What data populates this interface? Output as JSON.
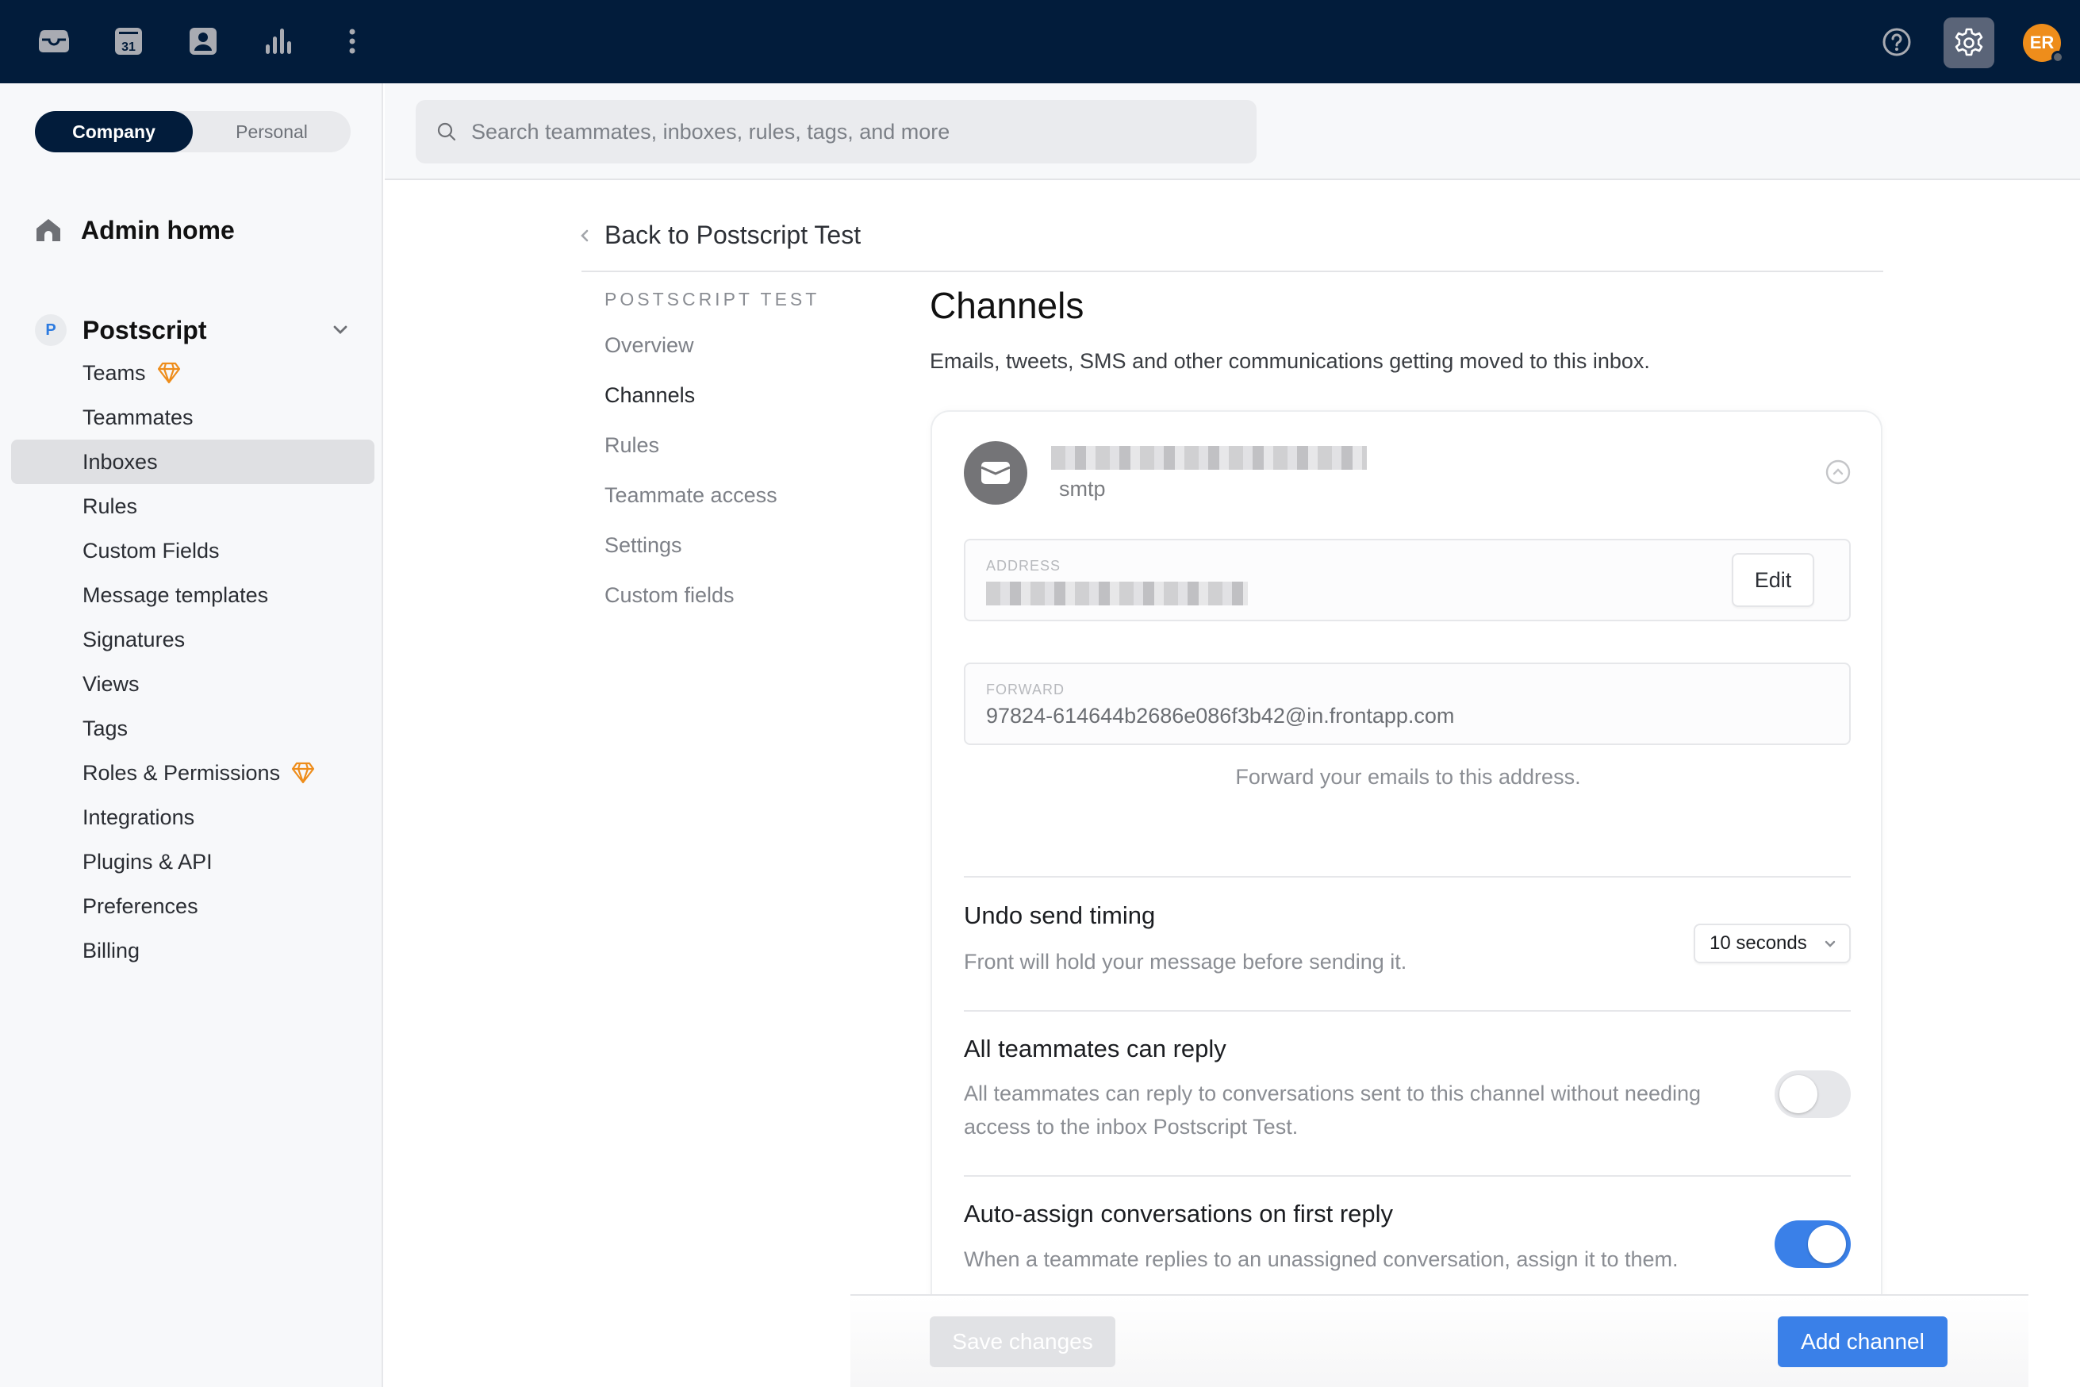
{
  "topbar": {
    "nav_icons": [
      "inbox-icon",
      "calendar-icon",
      "contacts-icon",
      "analytics-icon",
      "more-icon"
    ],
    "calendar_day": "31",
    "help_icon": "help-icon",
    "settings_icon": "gear-icon",
    "avatar_initials": "ER",
    "colors": {
      "bar": "#021c3b",
      "avatar": "#ee8d1b",
      "settings_active": "#5a6478"
    }
  },
  "sidebar": {
    "segments": {
      "company": "Company",
      "personal": "Personal",
      "selected": "Company"
    },
    "admin_home": "Admin home",
    "org": {
      "badge": "P",
      "name": "Postscript",
      "expanded": true
    },
    "items": [
      {
        "label": "Teams",
        "premium": true
      },
      {
        "label": "Teammates",
        "premium": false
      },
      {
        "label": "Inboxes",
        "premium": false,
        "active": true
      },
      {
        "label": "Rules",
        "premium": false
      },
      {
        "label": "Custom Fields",
        "premium": false
      },
      {
        "label": "Message templates",
        "premium": false
      },
      {
        "label": "Signatures",
        "premium": false
      },
      {
        "label": "Views",
        "premium": false
      },
      {
        "label": "Tags",
        "premium": false
      },
      {
        "label": "Roles & Permissions",
        "premium": true
      },
      {
        "label": "Integrations",
        "premium": false
      },
      {
        "label": "Plugins & API",
        "premium": false
      },
      {
        "label": "Preferences",
        "premium": false
      },
      {
        "label": "Billing",
        "premium": false
      }
    ]
  },
  "search": {
    "placeholder": "Search teammates, inboxes, rules, tags, and more",
    "value": ""
  },
  "breadcrumb": {
    "back_label": "Back to Postscript Test"
  },
  "subnav": {
    "title": "POSTSCRIPT TEST",
    "items": [
      "Overview",
      "Channels",
      "Rules",
      "Teammate access",
      "Settings",
      "Custom fields"
    ],
    "active": "Channels"
  },
  "main": {
    "title": "Channels",
    "description": "Emails, tweets, SMS and other communications getting moved to this inbox.",
    "channel": {
      "icon": "envelope-icon",
      "name_redacted": true,
      "type": "smtp",
      "address": {
        "label": "ADDRESS",
        "value_redacted": true,
        "edit_label": "Edit"
      },
      "forward": {
        "label": "FORWARD",
        "value": "97824-614644b2686e086f3b42@in.frontapp.com"
      },
      "forward_help": "Forward your emails to this address.",
      "settings": {
        "undo_send": {
          "title": "Undo send timing",
          "description": "Front will hold your message before sending it.",
          "selected": "10 seconds"
        },
        "all_teammates_reply": {
          "title": "All teammates can reply",
          "description": "All teammates can reply to conversations sent to this channel without needing access to the inbox Postscript Test.",
          "enabled": false
        },
        "auto_assign": {
          "title": "Auto-assign conversations on first reply",
          "description": "When a teammate replies to an unassigned conversation, assign it to them.",
          "enabled": true
        }
      }
    }
  },
  "footer": {
    "save_label": "Save changes",
    "save_disabled": true,
    "add_label": "Add channel",
    "accent": "#3a80e8"
  }
}
